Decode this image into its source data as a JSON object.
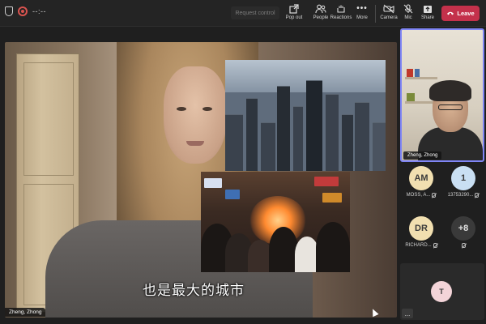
{
  "topbar": {
    "timer": "--:--",
    "request_control": "Request control",
    "buttons": {
      "pop_out": "Pop out",
      "people": "People",
      "reactions": "Reactions",
      "more": "More",
      "camera": "Camera",
      "mic": "Mic",
      "share": "Share",
      "leave": "Leave"
    },
    "icons": {
      "shield": "shield-icon",
      "record": "record-icon",
      "pop_out": "pop-out-icon",
      "people": "people-icon",
      "reactions": "reactions-icon",
      "more": "more-icon",
      "camera": "camera-off-icon",
      "mic": "mic-off-icon",
      "share": "share-icon",
      "leave": "phone-hangup-icon"
    },
    "colors": {
      "leave_bg": "#c4314b",
      "record": "#d9534f"
    }
  },
  "stage": {
    "subtitle": "也是最大的城市",
    "presenter_name": "Zheng, Zhong"
  },
  "right_panel": {
    "featured_name": "Zheng, Zhong",
    "featured_border_color": "#7f85f5",
    "participants": [
      {
        "initials": "AM",
        "name": "MOSS, A...",
        "color": "#f1dfb0",
        "muted": true
      },
      {
        "initials": "1",
        "name": "13753290...",
        "color": "#c9dff3",
        "muted": true
      },
      {
        "initials": "DR",
        "name": "RICHARD...",
        "color": "#f1dfb0",
        "muted": true
      },
      {
        "initials": "+8",
        "name": "",
        "color": "#3a3a3a",
        "muted": false
      }
    ],
    "bottom_avatar": {
      "initials": "T",
      "color": "#f3d4d8"
    },
    "more_menu": "..."
  }
}
